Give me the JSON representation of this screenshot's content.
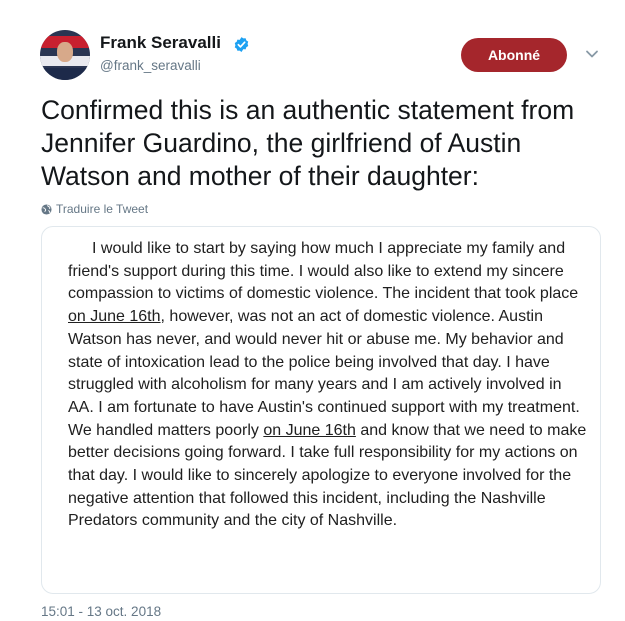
{
  "author": {
    "name": "Frank Seravalli",
    "handle": "@frank_seravalli",
    "verified": true
  },
  "follow_button": {
    "label": "Abonné"
  },
  "tweet": {
    "text": "Confirmed this is an authentic statement from Jennifer Guardino, the girlfriend of Austin Watson and mother of their daughter:",
    "translate_label": "Traduire le Tweet",
    "timestamp": "15:01 - 13 oct. 2018"
  },
  "statement": {
    "part1": "I would like to start by saying how much I appreciate my family and friend's support during this time.  I would also like to extend my sincere compassion to victims of domestic violence.  The incident that took place ",
    "date1": "on June 16th",
    "part2": ", however, was not an act of domestic violence.  Austin Watson has never, and would never hit or abuse me.  My behavior and state of intoxication lead to the police being involved that day.  I have struggled with alcoholism for many years and I am actively involved in AA.  I am fortunate to have Austin's continued support with my treatment.  We handled matters poorly ",
    "date2": "on June 16th",
    "part3": " and know that we need to make better decisions going forward.  I take full responsibility for my actions on that day.  I would like to sincerely apologize to everyone involved for the negative attention that followed this incident, including the Nashville Predators community and the city of Nashville."
  },
  "colors": {
    "follow_button_bg": "#a5262c",
    "verified_badge": "#1da1f2",
    "secondary_text": "#657786"
  },
  "icons": {
    "verified": "verified-badge-icon",
    "globe": "globe-icon",
    "more": "chevron-down-icon"
  }
}
